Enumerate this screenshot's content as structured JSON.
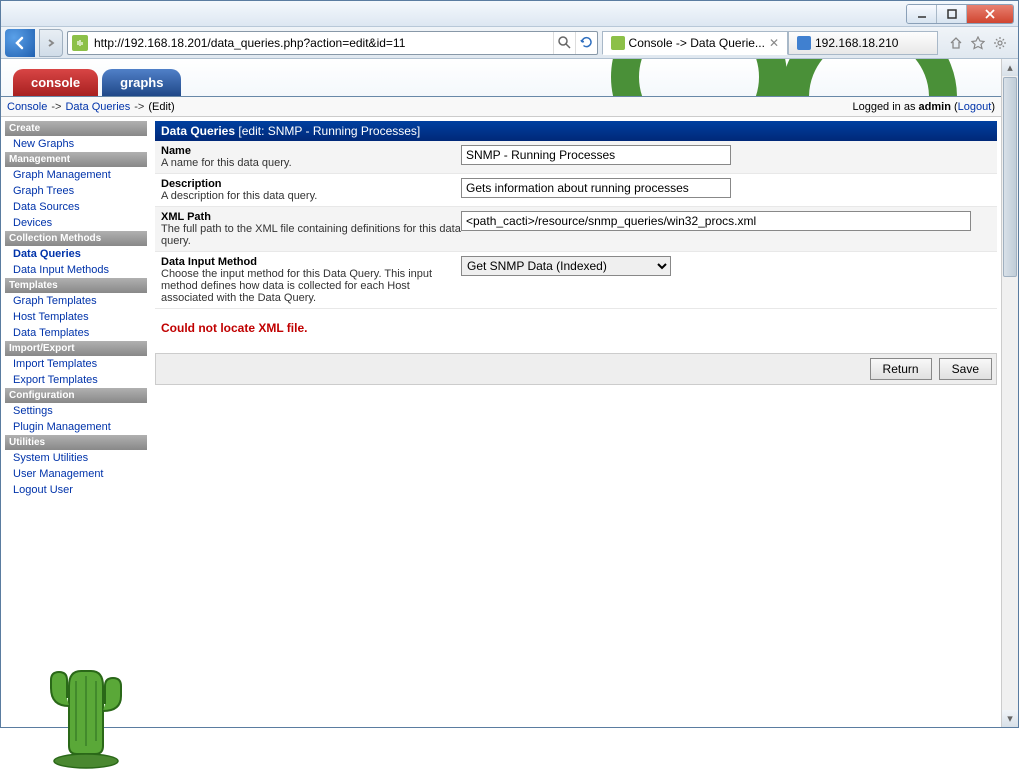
{
  "browser": {
    "url": "http://192.168.18.201/data_queries.php?action=edit&id=11",
    "tabs": [
      {
        "label": "Console -> Data Querie...",
        "active": true,
        "fav": "green"
      },
      {
        "label": "192.168.18.210",
        "active": false,
        "fav": "blue"
      }
    ]
  },
  "header": {
    "tab_console": "console",
    "tab_graphs": "graphs"
  },
  "breadcrumb": {
    "link1": "Console",
    "link2": "Data Queries",
    "current": "(Edit)",
    "logged_in_prefix": "Logged in as ",
    "user": "admin",
    "logout": "Logout"
  },
  "sidebar": {
    "sections": [
      {
        "header": "Create",
        "items": [
          {
            "label": "New Graphs"
          }
        ]
      },
      {
        "header": "Management",
        "items": [
          {
            "label": "Graph Management"
          },
          {
            "label": "Graph Trees"
          },
          {
            "label": "Data Sources"
          },
          {
            "label": "Devices"
          }
        ]
      },
      {
        "header": "Collection Methods",
        "items": [
          {
            "label": "Data Queries",
            "active": true
          },
          {
            "label": "Data Input Methods"
          }
        ]
      },
      {
        "header": "Templates",
        "items": [
          {
            "label": "Graph Templates"
          },
          {
            "label": "Host Templates"
          },
          {
            "label": "Data Templates"
          }
        ]
      },
      {
        "header": "Import/Export",
        "items": [
          {
            "label": "Import Templates"
          },
          {
            "label": "Export Templates"
          }
        ]
      },
      {
        "header": "Configuration",
        "items": [
          {
            "label": "Settings"
          },
          {
            "label": "Plugin Management"
          }
        ]
      },
      {
        "header": "Utilities",
        "items": [
          {
            "label": "System Utilities"
          },
          {
            "label": "User Management"
          },
          {
            "label": "Logout User"
          }
        ]
      }
    ]
  },
  "panel": {
    "title": "Data Queries",
    "subtitle": "[edit: SNMP - Running Processes]",
    "rows": [
      {
        "label": "Name",
        "desc": "A name for this data query.",
        "type": "text",
        "value": "SNMP - Running Processes"
      },
      {
        "label": "Description",
        "desc": "A description for this data query.",
        "type": "text",
        "value": "Gets information about running processes"
      },
      {
        "label": "XML Path",
        "desc": "The full path to the XML file containing definitions for this data query.",
        "type": "text_wide",
        "value": "<path_cacti>/resource/snmp_queries/win32_procs.xml"
      },
      {
        "label": "Data Input Method",
        "desc": "Choose the input method for this Data Query. This input method defines how data is collected for each Host associated with the Data Query.",
        "type": "select",
        "value": "Get SNMP Data (Indexed)"
      }
    ],
    "error": "Could not locate XML file.",
    "btn_return": "Return",
    "btn_save": "Save"
  }
}
